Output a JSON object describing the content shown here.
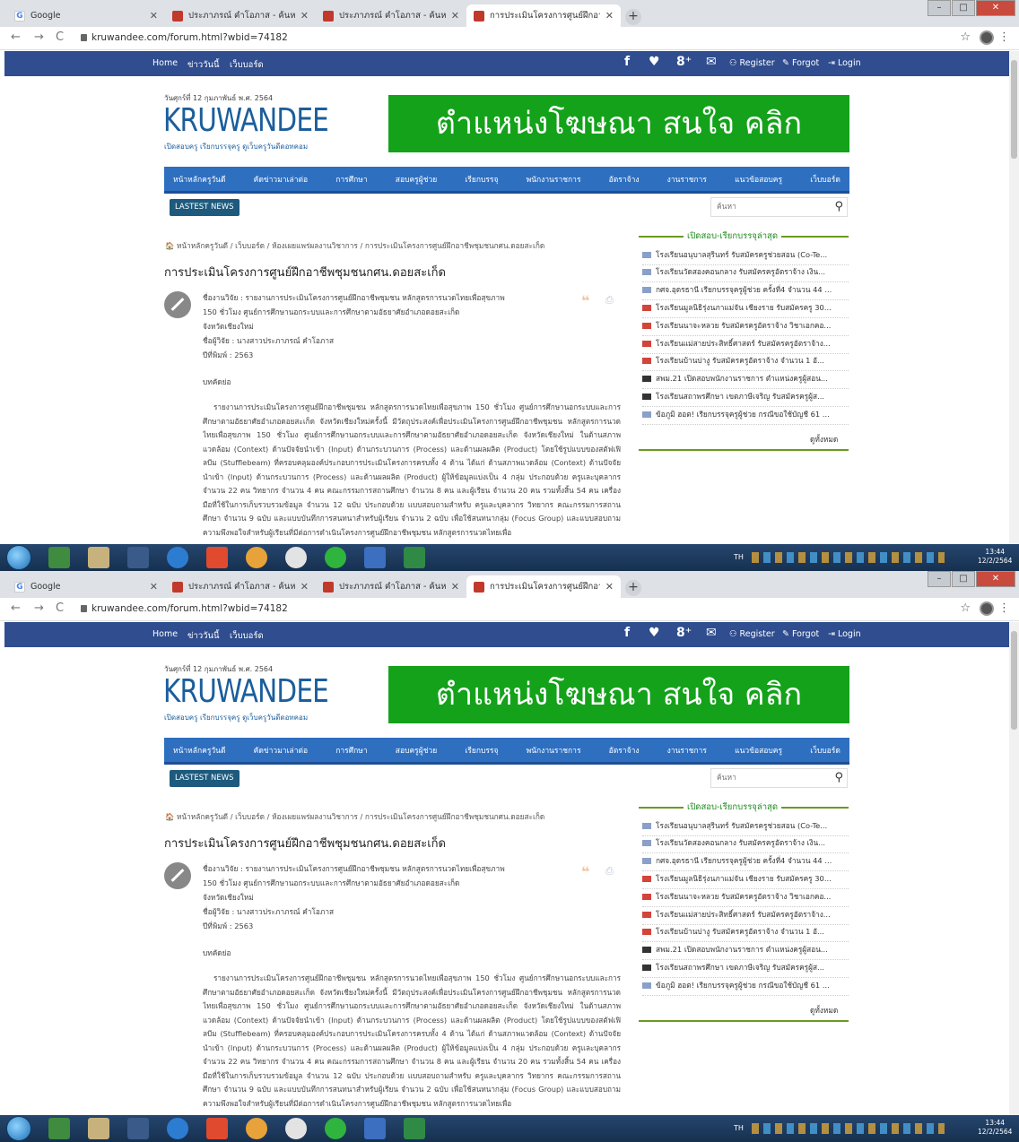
{
  "browser": {
    "tabs": [
      {
        "title": "Google",
        "favicon": "google-icon"
      },
      {
        "title": "ประภาภรณ์ คำโอภาส - ค้นหา",
        "favicon": "kruwandee-icon"
      },
      {
        "title": "ประภาภรณ์ คำโอภาส - ค้นหา",
        "favicon": "kruwandee-icon"
      },
      {
        "title": "การประเมินโครงการศูนย์ฝึกอาชีพช",
        "favicon": "kruwandee-icon"
      }
    ],
    "url": "kruwandee.com/forum.html?wbid=74182"
  },
  "topnav": {
    "links": [
      "Home",
      "ข่าววันนี้",
      "เว็บบอร์ด"
    ],
    "social": [
      "f",
      "♥",
      "8⁺",
      "✉"
    ],
    "register": "Register",
    "forgot": "Forgot",
    "login": "Login"
  },
  "header": {
    "date": "วันศุกร์ที่ 12 กุมภาพันธ์ พ.ศ. 2564",
    "logo": "KRUWANDEE",
    "tagline": "เปิดสอบครู เรียกบรรจุครู ดูเว็บครูวันดีดอทคอม",
    "ad": "ตำแหน่งโฆษณา สนใจ คลิก"
  },
  "menu": [
    "หน้าหลักครูวันดี",
    "คัดข่าวมาเล่าต่อ",
    "การศึกษา",
    "สอบครูผู้ช่วย",
    "เรียกบรรจุ",
    "พนักงานราชการ",
    "อัตราจ้าง",
    "งานราชการ",
    "แนวข้อสอบครู",
    "เว็บบอร์ด"
  ],
  "latest_news": "LASTEST NEWS",
  "search": {
    "placeholder": "ค้นหา"
  },
  "breadcrumb": "🏠 หน้าหลักครูวันดี / เว็บบอร์ด / ห้องเผยแพร่ผลงานวิชาการ / การประเมินโครงการศูนย์ฝึกอาชีพชุมชนกศน.ดอยสะเก็ด",
  "post": {
    "title": "การประเมินโครงการศูนย์ฝึกอาชีพชุมชนกศน.ดอยสะเก็ด",
    "meta_line1": "ชื่องานวิจัย : รายงานการประเมินโครงการศูนย์ฝึกอาชีพชุมชน หลักสูตรการนวดไทยเพื่อสุขภาพ",
    "meta_line2": "150 ชั่วโมง ศูนย์การศึกษานอกระบบและการศึกษาตามอัธยาศัยอำเภอดอยสะเก็ด",
    "meta_line3": "จังหวัดเชียงใหม่",
    "researcher": "ชื่อผู้วิจัย :  นางสาวประภาภรณ์ คำโอภาส",
    "year": "ปีที่พิมพ์ :  2563",
    "abstract_heading": "บทคัดย่อ",
    "abstract": "รายงานการประเมินโครงการศูนย์ฝึกอาชีพชุมชน หลักสูตรการนวดไทยเพื่อสุขภาพ 150 ชั่วโมง ศูนย์การศึกษานอกระบบและการศึกษาตามอัธยาศัยอำเภอดอยสะเก็ด จังหวัดเชียงใหม่ครั้งนี้ มีวัตถุประสงค์เพื่อประเมินโครงการศูนย์ฝึกอาชีพชุมชน หลักสูตรการนวดไทยเพื่อสุขภาพ 150 ชั่วโมง ศูนย์การศึกษานอกระบบและการศึกษาตามอัธยาศัยอำเภอดอยสะเก็ด จังหวัดเชียงใหม่ ในด้านสภาพแวดล้อม (Context) ด้านปัจจัยนำเข้า (Input) ด้านกระบวนการ (Process) และด้านผลผลิต (Product) โดยใช้รูปแบบของสตัฟเฟิลบีม (Stufflebeam) ที่ครอบคลุมองค์ประกอบการประเมินโครงการครบทั้ง 4 ด้าน ได้แก่ ด้านสภาพแวดล้อม (Context) ด้านปัจจัยนำเข้า (Input) ด้านกระบวนการ (Process) และด้านผลผลิต (Product) ผู้ให้ข้อมูลแบ่งเป็น 4 กลุ่ม ประกอบด้วย ครูและบุคลากร จำนวน 22 คน วิทยากร จำนวน 4 คน คณะกรรมการสถานศึกษา จำนวน 8 คน และผู้เรียน จำนวน 20 คน รวมทั้งสิ้น 54 คน เครื่องมือที่ใช้ในการเก็บรวบรวมข้อมูล จำนวน 12 ฉบับ ประกอบด้วย แบบสอบถามสำหรับ ครูและบุคลากร วิทยากร คณะกรรมการสถานศึกษา จำนวน 9 ฉบับ และแบบบันทึกการสนทนาสำหรับผู้เรียน จำนวน 2 ฉบับ เพื่อใช้สนทนากลุ่ม (Focus Group) และแบบสอบถามความพึงพอใจสำหรับผู้เรียนที่มีต่อการดำเนินโครงการศูนย์ฝึกอาชีพชุมชน หลักสูตรการนวดไทยเพื่อ"
  },
  "sidebar": {
    "heading": "เปิดสอบ-เรียกบรรจุล่าสุด",
    "items": [
      "โรงเรียนอนุบาลสุรินทร์ รับสมัครครูช่วยสอน (Co-Te...",
      "โรงเรียนวัดสองคอนกลาง รับสมัครครูอัตราจ้าง เงิน...",
      "กศจ.อุดรธานี เรียกบรรจุครูผู้ช่วย ครั้งที่4 จำนวน 44 ...",
      "โรงเรียนมูลนิธิรุ่งนภาแม่จัน เชียงราย รับสมัครครู 30...",
      "โรงเรียนนาจะหลวย รับสมัครครูอัตราจ้าง วิชาเอกคอ...",
      "โรงเรียนแม่สายประสิทธิ์ศาสตร์ รับสมัครครูอัตราจ้าง...",
      "โรงเรียนบ้านบ่างู รับสมัครครูอัตราจ้าง จำนวน 1 อั...",
      "สพม.21 เปิดสอบพนักงานราชการ ตำแหน่งครูผู้สอน...",
      "โรงเรียนสถาพรศึกษา เขตภาษีเจริญ รับสมัครครูผู้ส...",
      "ข้อภูมิ ฮอต! เรียกบรรจุครูผู้ช่วย กรณีขอใช้บัญชี 61 ..."
    ],
    "icon_colors": [
      "#8aa0c8",
      "#8aa0c8",
      "#8aa0c8",
      "#d3443a",
      "#d3443a",
      "#d3443a",
      "#d3443a",
      "#333333",
      "#333333",
      "#8aa0c8"
    ],
    "see_all": "ดูทั้งหมด"
  },
  "taskbar": {
    "lang": "TH",
    "time": "13:44",
    "date": "12/2/2564"
  },
  "colors": {
    "sitebar": "#2f4d8f",
    "menu": "#2e6fc0",
    "ad": "#14a21a",
    "logo": "#1b5e9c"
  }
}
